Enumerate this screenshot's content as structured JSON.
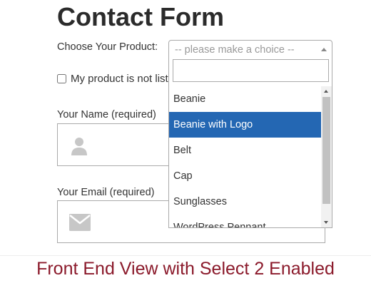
{
  "page": {
    "title": "Contact Form"
  },
  "form": {
    "product_label": "Choose Your Product:",
    "product_placeholder": "-- please make a choice --",
    "checkbox_label": "My product is not listed",
    "name_label": "Your Name (required)",
    "email_label": "Your Email (required)"
  },
  "dropdown": {
    "search_value": "",
    "items": [
      {
        "label": "Beanie",
        "highlighted": false
      },
      {
        "label": "Beanie with Logo",
        "highlighted": true
      },
      {
        "label": "Belt",
        "highlighted": false
      },
      {
        "label": "Cap",
        "highlighted": false
      },
      {
        "label": "Sunglasses",
        "highlighted": false
      },
      {
        "label": "WordPress Pennant",
        "highlighted": false
      }
    ]
  },
  "caption": "Front End View with Select 2 Enabled",
  "colors": {
    "highlight": "#2467b3",
    "caption": "#8b1a2b",
    "icon": "#c7c7c7"
  },
  "icons": {
    "name_field": "user-icon",
    "email_field": "envelope-icon"
  }
}
